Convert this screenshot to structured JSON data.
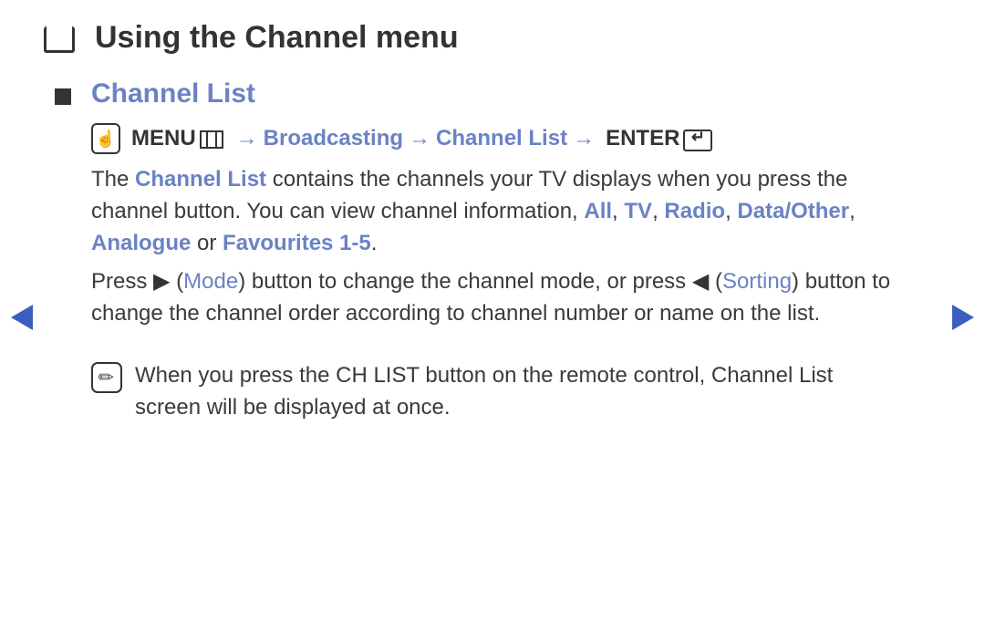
{
  "title": "Using the Channel menu",
  "section": {
    "heading": "Channel List",
    "path": {
      "menu_label": "MENU",
      "segments": [
        "Broadcasting",
        "Channel List"
      ],
      "enter_label": "ENTER"
    }
  },
  "body": {
    "p1": {
      "t0": "The ",
      "channel_list": "Channel List",
      "t1": " contains the channels your TV displays when you press the channel button. You can view channel information, ",
      "all": "All",
      "c1": ", ",
      "tv": "TV",
      "c2": ", ",
      "radio": "Radio",
      "c3": ", ",
      "data_other": "Data/Other",
      "c4": ", ",
      "analogue": "Analogue",
      "or": " or ",
      "favourites": "Favourites 1-5",
      "end": "."
    },
    "p2": {
      "t0": "Press ",
      "right_glyph": "▶",
      "t1": " (",
      "mode": "Mode",
      "t2": ") button to change the channel mode, or press ",
      "left_glyph": "◀",
      "t3": " (",
      "sorting": "Sorting",
      "t4": ") button to change the channel order according to channel number or name on the list."
    }
  },
  "note": {
    "t0": "When you press the ",
    "ch_list": "CH LIST",
    "t1": " button on the remote control, ",
    "channel_list": "Channel List",
    "t2": " screen will be displayed at once."
  }
}
